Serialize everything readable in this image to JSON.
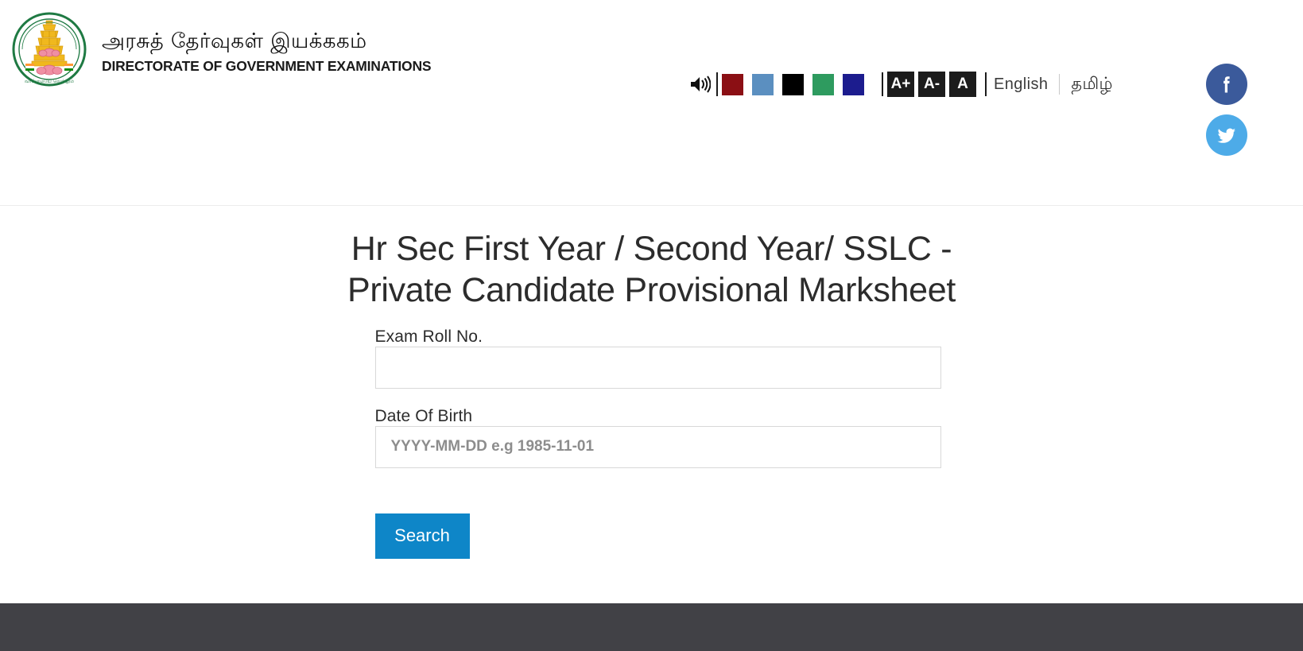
{
  "header": {
    "emblem_icon": "tamil-nadu-government-emblem",
    "brand_tamil": "அரசுத் தேர்வுகள் இயக்ககம்",
    "brand_english": "DIRECTORATE OF GOVERNMENT EXAMINATIONS",
    "accessibility": {
      "speaker_icon": "speaker-volume-icon",
      "themes": [
        {
          "name": "theme-dark-red",
          "color": "#8b0f14"
        },
        {
          "name": "theme-steel-blue",
          "color": "#5b8fc0"
        },
        {
          "name": "theme-black",
          "color": "#000000"
        },
        {
          "name": "theme-green",
          "color": "#2e9b5f"
        },
        {
          "name": "theme-navy",
          "color": "#1c1c8e"
        }
      ],
      "font_buttons": [
        {
          "name": "font-increase",
          "label": "A+"
        },
        {
          "name": "font-decrease",
          "label": "A-"
        },
        {
          "name": "font-reset",
          "label": "A"
        }
      ]
    },
    "languages": [
      {
        "name": "language-english",
        "label": "English"
      },
      {
        "name": "language-tamil",
        "label": "தமிழ்"
      }
    ],
    "social": [
      {
        "name": "facebook",
        "icon": "facebook-icon",
        "color": "#3b5a9b"
      },
      {
        "name": "twitter",
        "icon": "twitter-icon",
        "color": "#4dabe8"
      }
    ]
  },
  "main": {
    "page_title": "Hr Sec First Year / Second Year/ SSLC - Private Candidate Provisional Marksheet",
    "fields": {
      "roll_no": {
        "label": "Exam Roll No.",
        "value": "",
        "placeholder": ""
      },
      "dob": {
        "label": "Date Of Birth",
        "value": "",
        "placeholder": "YYYY-MM-DD e.g 1985-11-01"
      }
    },
    "search_button": {
      "label": "Search",
      "color": "#0e86c8"
    }
  },
  "footer": {
    "color": "#414146"
  }
}
